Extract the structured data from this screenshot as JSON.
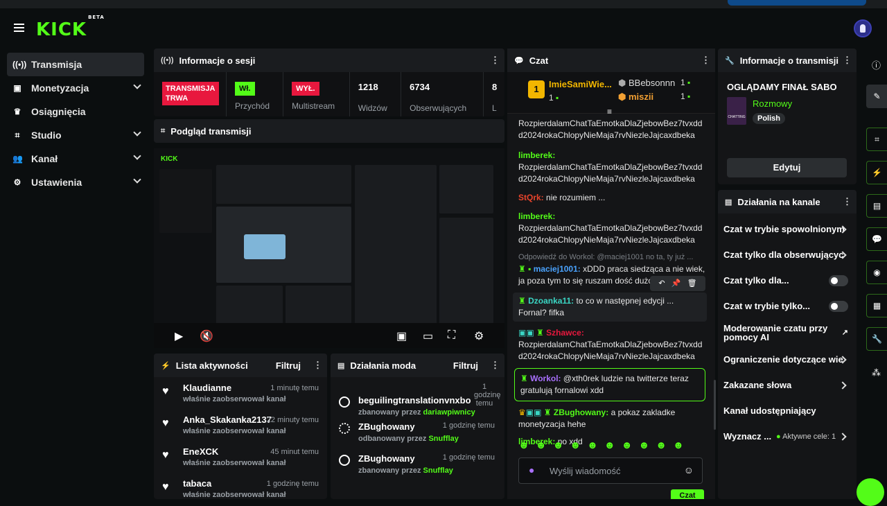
{
  "brand": {
    "logo": "KICK",
    "beta": "BETA",
    "accent": "#53fc18"
  },
  "sidebar": {
    "items": [
      {
        "label": "Transmisja",
        "icon": "broadcast-icon"
      },
      {
        "label": "Monetyzacja",
        "icon": "wallet-icon"
      },
      {
        "label": "Osiągnięcia",
        "icon": "trophy-icon"
      },
      {
        "label": "Studio",
        "icon": "studio-icon"
      },
      {
        "label": "Kanał",
        "icon": "users-icon"
      },
      {
        "label": "Ustawienia",
        "icon": "gear-icon"
      }
    ]
  },
  "session": {
    "title": "Informacje o sesji",
    "live_badge_1": "TRANSMISJA",
    "live_badge_2": "TRWA",
    "income_toggle": "Wł.",
    "income_label": "Przychód",
    "multistream_toggle": "WYŁ.",
    "multistream_label": "Multistream",
    "viewers": "1218",
    "viewers_label": "Widzów",
    "followers": "6734",
    "followers_label": "Obserwujących",
    "extra_num": "8",
    "extra_label": "L"
  },
  "preview": {
    "title": "Podgląd transmisji"
  },
  "activity": {
    "title": "Lista aktywności",
    "filter": "Filtruj",
    "items": [
      {
        "name": "Klaudianne",
        "sub": "właśnie zaobserwował kanał",
        "time": "1 minutę temu"
      },
      {
        "name": "Anka_Skakanka2137",
        "sub": "właśnie zaobserwował kanał",
        "time": "22 minuty temu"
      },
      {
        "name": "EneXCK",
        "sub": "właśnie zaobserwował kanał",
        "time": "45 minut temu"
      },
      {
        "name": "tabaca",
        "sub": "właśnie zaobserwował kanał",
        "time": "1 godzinę temu"
      }
    ]
  },
  "mod": {
    "title": "Działania moda",
    "filter": "Filtruj",
    "items": [
      {
        "name": "beguilingtranslationvnxbo",
        "sub": "zbanowany przez",
        "by": "dariawpiwnicy",
        "time": "1 godzinę temu"
      },
      {
        "name": "ZBughowany",
        "sub": "odbanowany przez",
        "by": "Snufflay",
        "time": "1 godzinę temu"
      },
      {
        "name": "ZBughowany",
        "sub": "zbanowany przez",
        "by": "Snufflay",
        "time": "1 godzinę temu"
      }
    ]
  },
  "chat": {
    "title": "Czat",
    "top1": {
      "name": "ImieSamiWie...",
      "count": "1"
    },
    "top2": {
      "name": "BBebsonnn",
      "count": "1"
    },
    "top3": {
      "name": "miszii",
      "count": "1"
    },
    "messages": [
      {
        "user": "",
        "text": "RozpierdalamChatTaEmotkaDlaZjebowBez7tvxdd d2024rokaChlopyNieMaja7rvNiezleJajcaxdbeka"
      },
      {
        "user": "limberek:",
        "text": "RozpierdalamChatTaEmotkaDlaZjebowBez7tvxdd d2024rokaChlopyNieMaja7rvNiezleJajcaxdbeka"
      },
      {
        "user": "StQrk:",
        "text": "nie rozumiem ..."
      },
      {
        "user": "limberek:",
        "text": "RozpierdalamChatTaEmotkaDlaZjebowBez7tvxdd d2024rokaChlopyNieMaja7rvNiezleJajcaxdbeka"
      },
      {
        "reply": "Odpowiedź do Workol: @maciej1001 no ta, ty już ...",
        "user": "maciej1001:",
        "text": "xDDD praca siedząca a nie wiek, ja poza tym to się ruszam dość dużo"
      },
      {
        "user": "Dzoanka11:",
        "text": "to co w następnej edycji ... Fornal? fifka"
      },
      {
        "user": "Szhawce:",
        "text": "RozpierdalamChatTaEmotkaDlaZjebowBez7tvxdd d2024rokaChlopyNieMaja7rvNiezleJajcaxdbeka"
      },
      {
        "user": "Workol:",
        "text": "@xth0rek ludzie na twitterze teraz gratulują fornalowi xdd"
      },
      {
        "user": "ZBughowany:",
        "text": "a pokaz zakladke monetyzacja hehe"
      },
      {
        "user": "limberek:",
        "text": "no xdd"
      }
    ],
    "input_placeholder": "Wyślij wiadomość",
    "send": "Czat"
  },
  "stream_info": {
    "title": "Informacje o transmisji",
    "stream_title": "OGLĄDAMY FINAŁ SABO",
    "category": "Rozmowy",
    "language": "Polish",
    "thumb_text": "CHATTING",
    "edit": "Edytuj"
  },
  "channel_actions": {
    "title": "Działania na kanale",
    "items": [
      {
        "label": "Czat w trybie spowolnionym",
        "kind": "chevron"
      },
      {
        "label": "Czat tylko dla obserwującyc",
        "kind": "chevron"
      },
      {
        "label": "Czat tylko dla...",
        "kind": "toggle"
      },
      {
        "label": "Czat w trybie tylko...",
        "kind": "toggle"
      },
      {
        "label": "Moderowanie czatu przy pomocy AI",
        "kind": "external"
      },
      {
        "label": "Ograniczenie dotyczące wie",
        "kind": "chevron"
      },
      {
        "label": "Zakazane słowa",
        "kind": "chevron"
      },
      {
        "label": "Kanał udostępniający",
        "kind": "none"
      },
      {
        "label": "Wyznacz ...",
        "kind": "chevron",
        "extra": "Aktywne cele: 1"
      }
    ]
  }
}
